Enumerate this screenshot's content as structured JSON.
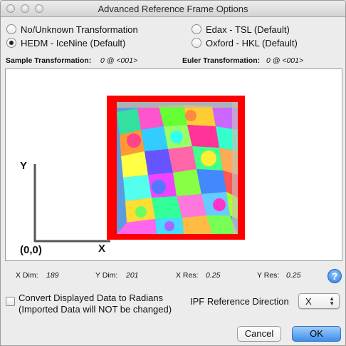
{
  "window": {
    "title": "Advanced Reference Frame Options"
  },
  "radios": [
    {
      "label": "No/Unknown Transformation",
      "checked": false
    },
    {
      "label": "Edax - TSL (Default)",
      "checked": false
    },
    {
      "label": "HEDM - IceNine (Default)",
      "checked": true
    },
    {
      "label": "Oxford - HKL (Default)",
      "checked": false
    }
  ],
  "transforms": {
    "sample_label": "Sample Transformation:",
    "sample_value": "0 @ <001>",
    "euler_label": "Euler Transformation:",
    "euler_value": "0 @ <001>"
  },
  "preview": {
    "y_axis": "Y",
    "x_axis": "X",
    "origin": "(0,0)"
  },
  "info": {
    "x_dim_label": "X Dim:",
    "x_dim_value": "189",
    "y_dim_label": "Y Dim:",
    "y_dim_value": "201",
    "x_res_label": "X Res:",
    "x_res_value": "0.25",
    "y_res_label": "Y Res:",
    "y_res_value": "0.25"
  },
  "help_label": "?",
  "convert": {
    "line1": "Convert Displayed Data to Radians",
    "line2": "(Imported Data will NOT be changed)",
    "checked": false
  },
  "ipf": {
    "label": "IPF Reference Direction",
    "selected": "X"
  },
  "buttons": {
    "cancel": "Cancel",
    "ok": "OK"
  }
}
